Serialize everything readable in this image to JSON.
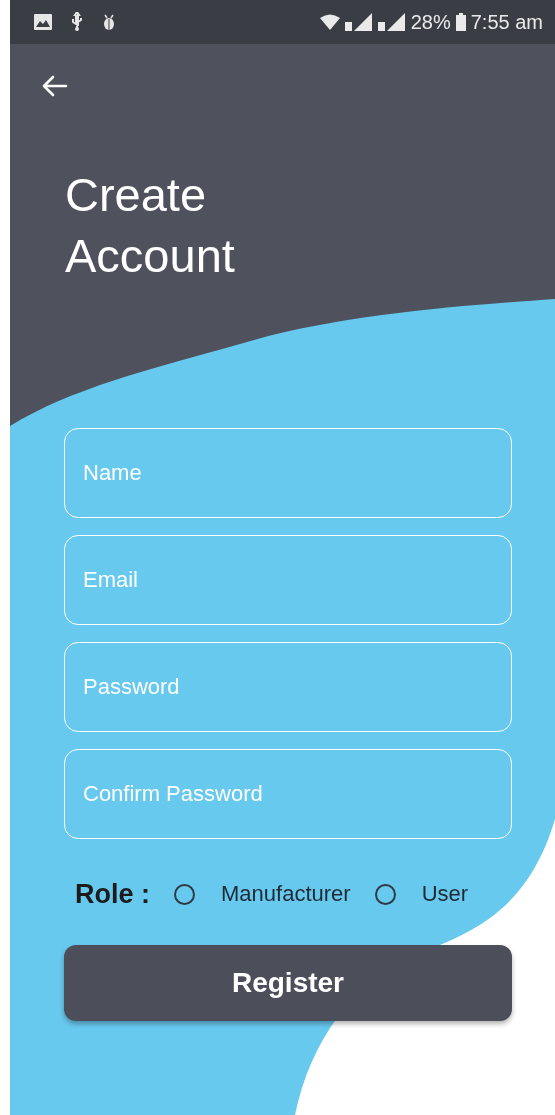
{
  "status_bar": {
    "battery": "28%",
    "time": "7:55 am"
  },
  "title": "Create Account",
  "fields": [
    {
      "placeholder": "Name"
    },
    {
      "placeholder": "Email"
    },
    {
      "placeholder": "Password"
    },
    {
      "placeholder": "Confirm Password"
    }
  ],
  "role": {
    "label": "Role :",
    "options": [
      {
        "label": "Manufacturer",
        "selected": false
      },
      {
        "label": "User",
        "selected": false
      }
    ]
  },
  "submit_button": "Register"
}
